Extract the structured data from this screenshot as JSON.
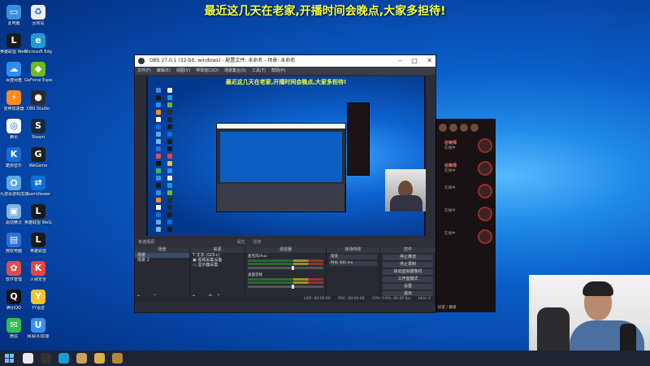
{
  "banner": {
    "text": "最近这几天在老家,开播时间会晚点,大家多担待!"
  },
  "desktop_icons": [
    {
      "label": "此电脑",
      "color": "#3a8ee6",
      "glyph": "▭"
    },
    {
      "label": "回收站",
      "color": "#f0f0f0",
      "glyph": "♻"
    },
    {
      "label": "英雄联盟 WeGame版",
      "color": "#1a1a1a",
      "glyph": "L"
    },
    {
      "label": "Microsoft Edge",
      "color": "#1c9bd8",
      "glyph": "e"
    },
    {
      "label": "百度网盘",
      "color": "#2e8df2",
      "glyph": "☁"
    },
    {
      "label": "GeForce Experience",
      "color": "#6dbb1f",
      "glyph": "◆"
    },
    {
      "label": "雷神加速器",
      "color": "#ff8a1d",
      "glyph": "⚡"
    },
    {
      "label": "OBS Studio",
      "color": "#2b2b2b",
      "glyph": "●"
    },
    {
      "label": "腾讯",
      "color": "#ffffff",
      "glyph": "◎"
    },
    {
      "label": "Steam",
      "color": "#1b2838",
      "glyph": "S"
    },
    {
      "label": "酷狗音乐",
      "color": "#1b6bd6",
      "glyph": "K"
    },
    {
      "label": "WeGame",
      "color": "#1e1e1e",
      "glyph": "G"
    },
    {
      "label": "九游会游戏加速",
      "color": "#5ca8e8",
      "glyph": "⛭"
    },
    {
      "label": "TeamViewer",
      "color": "#0e6fd8",
      "glyph": "⇄"
    },
    {
      "label": "驱动精灵",
      "color": "#7fb5e0",
      "glyph": "▣"
    },
    {
      "label": "英雄联盟 WeGame版",
      "color": "#1a1a1a",
      "glyph": "L"
    },
    {
      "label": "微软电脑",
      "color": "#2d6ee0",
      "glyph": "▤"
    },
    {
      "label": "英雄联盟",
      "color": "#1a1a1a",
      "glyph": "L"
    },
    {
      "label": "软件管理",
      "color": "#e04c4c",
      "glyph": "✿"
    },
    {
      "label": "火绒安全",
      "color": "#e9453b",
      "glyph": "K"
    },
    {
      "label": "腾讯QQ",
      "color": "#111111",
      "glyph": "Q"
    },
    {
      "label": "YY语音",
      "color": "#f5c52a",
      "glyph": "Y"
    },
    {
      "label": "微信",
      "color": "#2fbf55",
      "glyph": "✉"
    },
    {
      "label": "网易UU加速",
      "color": "#3b8ef0",
      "glyph": "U"
    }
  ],
  "obs": {
    "title": "OBS 27.0.1 (32-bit, windows) - 配置文件: 未命名 - 场景: 未命名",
    "menu": [
      "文件(F)",
      "编辑(E)",
      "视图(V)",
      "停靠窗口(D)",
      "场景集合(S)",
      "工具(T)",
      "帮助(H)"
    ],
    "preview_banner": "最近这几天在老家,开播时间会晚点,大家多担待!",
    "context_label": "未选择源",
    "context_buttons": [
      "属性",
      "滤镜"
    ],
    "docks": {
      "scenes": {
        "title": "场景",
        "items": [
          "场景",
          "场景 2"
        ]
      },
      "sources": {
        "title": "来源",
        "items": [
          "文本 (GDI+)",
          "视频采集设备",
          "显示器采集"
        ]
      },
      "mixer": {
        "title": "混音器",
        "channels": [
          {
            "name": "麦克风/Aux"
          },
          {
            "name": "桌面音频"
          }
        ]
      },
      "transitions": {
        "title": "转场特效",
        "type": "渐变",
        "duration_label": "时长",
        "duration": "300 ms"
      },
      "controls": {
        "title": "控件",
        "buttons": [
          "停止推流",
          "停止录制",
          "启动虚拟摄像机",
          "工作室模式",
          "设置",
          "退出"
        ]
      }
    },
    "status": {
      "live": "LIVE: 00:00:00",
      "rec": "REC: 00:00:00",
      "cpu": "CPU: 0.9%, 60.00 fps",
      "kbps": "kb/s: 0"
    }
  },
  "game_panel": {
    "players": [
      {
        "name": "召唤师",
        "status": "在线中"
      },
      {
        "name": "召唤师",
        "status": "在线中"
      },
      {
        "name": "",
        "status": "在线中"
      },
      {
        "name": "",
        "status": "在线中"
      },
      {
        "name": "",
        "status": "在线中"
      }
    ],
    "bottom_text": "好友 / 群组"
  },
  "taskbar": {
    "apps": [
      {
        "name": "search",
        "color": "#e9e9e9"
      },
      {
        "name": "obs",
        "color": "#333333"
      },
      {
        "name": "edge",
        "color": "#1c9bd8"
      },
      {
        "name": "lol",
        "color": "#c8a25a"
      },
      {
        "name": "wegame",
        "color": "#d9b24b"
      },
      {
        "name": "lol2",
        "color": "#b08a3a"
      }
    ]
  }
}
